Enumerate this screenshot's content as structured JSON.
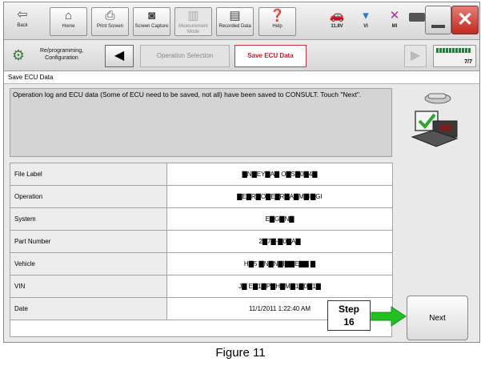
{
  "toolbar": {
    "back": "Back",
    "home": "Home",
    "print_screen": "Print Screen",
    "screen_capture": "Screen Capture",
    "measurement_mode": "Measurement Mode",
    "recorded_data": "Recorded Data",
    "help": "Help",
    "voltage": "11.8V",
    "vi": "VI",
    "mi": "MI"
  },
  "nav": {
    "reprogramming": "Re/programming, Configuration",
    "breadcrumb_1": "Operation Selection",
    "breadcrumb_2": "Save ECU Data",
    "page_counter": "7/7",
    "progress_fraction": 1.0
  },
  "page_title": "Save ECU Data",
  "message": "Operation log and ECU data (Some of ECU need to be saved, not all) have been saved to CONSULT. Touch \"Next\".",
  "table": [
    {
      "label": "File Label",
      "value": "▇N▇EY▇A▇ O▇S▇0▇4▇"
    },
    {
      "label": "Operation",
      "value": "▇E▇R▇O▇E▇R▇A▇M▇I▇GI"
    },
    {
      "label": "System",
      "value": "E▇G▇N▇"
    },
    {
      "label": "Part Number",
      "value": "2▇7▇-▇0▇A▇"
    },
    {
      "label": "Vehicle",
      "value": "H▇5 ▇N▇N▇I▇▇E▇▇ ▇"
    },
    {
      "label": "VIN",
      "value": "J▇ E▇1▇P▇H▇M▇1▇0▇1▇"
    },
    {
      "label": "Date",
      "value": "11/1/2011 1:22:40 AM"
    }
  ],
  "step": {
    "line1": "Step",
    "line2": "16"
  },
  "next_button": "Next",
  "caption": "Figure 11",
  "colors": {
    "arrow": "#22c021",
    "breadcrumb_active": "#c01c2c",
    "progress": "#0a8f2e"
  }
}
